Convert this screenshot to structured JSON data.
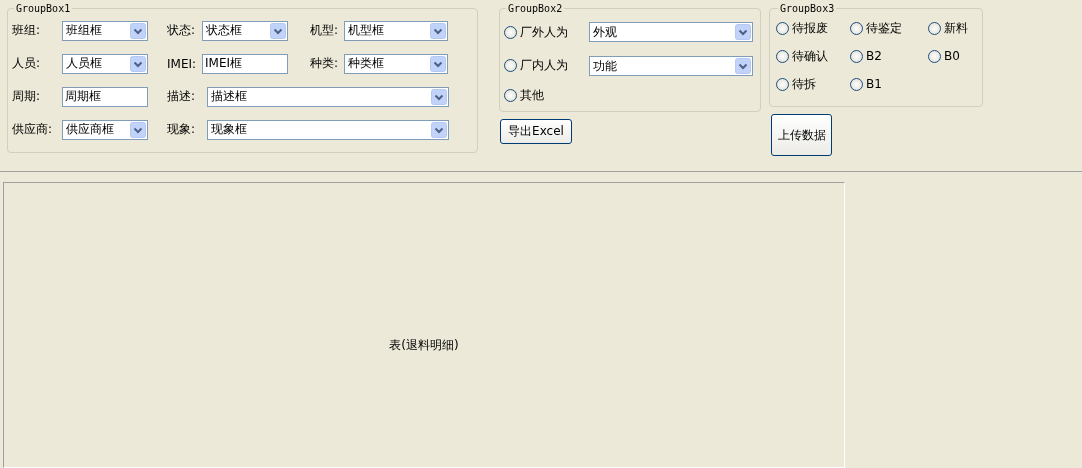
{
  "group1": {
    "title": "GroupBox1",
    "rows": [
      {
        "fields": [
          {
            "label": "班组:",
            "kind": "combo",
            "value": "班组框"
          },
          {
            "label": "状态:",
            "kind": "combo",
            "value": "状态框"
          },
          {
            "label": "机型:",
            "kind": "combo",
            "value": "机型框"
          }
        ]
      },
      {
        "fields": [
          {
            "label": "人员:",
            "kind": "combo",
            "value": "人员框"
          },
          {
            "label": "IMEI:",
            "kind": "text",
            "value": "IMEI框"
          },
          {
            "label": "种类:",
            "kind": "combo",
            "value": "种类框"
          }
        ]
      },
      {
        "fields": [
          {
            "label": "周期:",
            "kind": "text",
            "value": "周期框"
          },
          {
            "label": "描述:",
            "kind": "combo",
            "value": "描述框"
          }
        ]
      },
      {
        "fields": [
          {
            "label": "供应商:",
            "kind": "combo",
            "value": "供应商框"
          },
          {
            "label": "现象:",
            "kind": "combo",
            "value": "现象框"
          }
        ]
      }
    ]
  },
  "group2": {
    "title": "GroupBox2",
    "radios": [
      {
        "label": "厂外人为",
        "selected": false
      },
      {
        "label": "厂内人为",
        "selected": false
      },
      {
        "label": "其他",
        "selected": false
      }
    ],
    "combos": [
      "外观",
      "功能"
    ]
  },
  "export_button": "导出Excel",
  "group3": {
    "title": "GroupBox3",
    "radios": [
      {
        "label": "待报废",
        "selected": false
      },
      {
        "label": "待确认",
        "selected": false
      },
      {
        "label": "待拆",
        "selected": false
      },
      {
        "label": "待鉴定",
        "selected": false
      },
      {
        "label": "B2",
        "selected": false
      },
      {
        "label": "B1",
        "selected": false
      },
      {
        "label": "新料",
        "selected": false
      },
      {
        "label": "B0",
        "selected": false
      }
    ]
  },
  "upload_button": "上传数据",
  "table": {
    "caption": "表(退料明细)"
  }
}
